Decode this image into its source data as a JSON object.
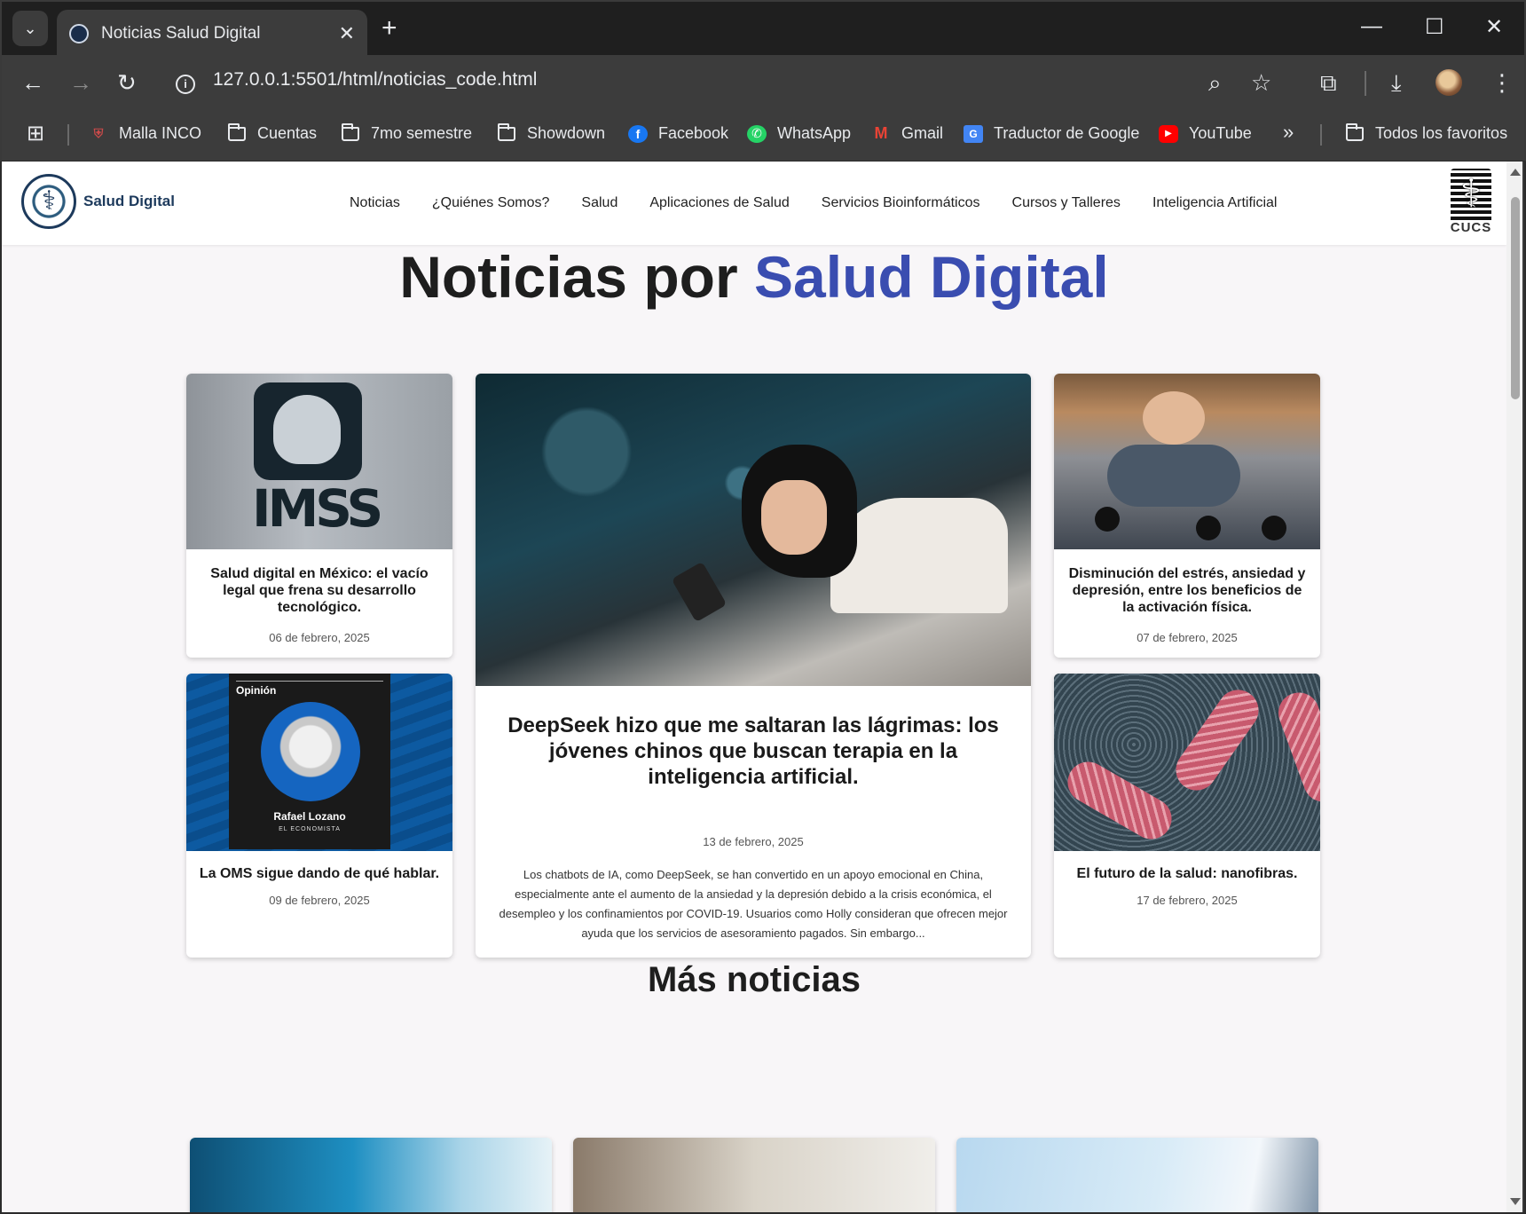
{
  "browser": {
    "tab_title": "Noticias Salud Digital",
    "url": "127.0.0.1:5501/html/noticias_code.html",
    "bookmarks": [
      {
        "label": "Malla INCO",
        "icon": "site-icon"
      },
      {
        "label": "Cuentas",
        "icon": "folder-icon"
      },
      {
        "label": "7mo semestre",
        "icon": "folder-icon"
      },
      {
        "label": "Showdown",
        "icon": "folder-icon"
      },
      {
        "label": "Facebook",
        "icon": "facebook-icon"
      },
      {
        "label": "WhatsApp",
        "icon": "whatsapp-icon"
      },
      {
        "label": "Gmail",
        "icon": "gmail-icon"
      },
      {
        "label": "Traductor de Google",
        "icon": "google-translate-icon"
      },
      {
        "label": "YouTube",
        "icon": "youtube-icon"
      }
    ],
    "all_bookmarks_label": "Todos los favoritos"
  },
  "site": {
    "logo_text": "Salud Digital",
    "nav": [
      "Noticias",
      "¿Quiénes Somos?",
      "Salud",
      "Aplicaciones de Salud",
      "Servicios Bioinformáticos",
      "Cursos y Talleres",
      "Inteligencia Artificial"
    ],
    "cucs_label": "CUCS"
  },
  "hero": {
    "title_main": "Noticias por ",
    "title_accent": "Salud Digital",
    "accent_color": "#3a4db0"
  },
  "news": {
    "card1": {
      "title": "Salud digital en México: el vacío legal que frena su desarrollo tecnológico.",
      "date": "06 de febrero, 2025",
      "image_text": "IMSS"
    },
    "card2": {
      "title": "La OMS sigue dando de qué hablar.",
      "date": "09 de febrero, 2025",
      "image_label": "Opinión",
      "image_name": "Rafael Lozano",
      "image_pub": "EL ECONOMISTA"
    },
    "featured": {
      "title": "DeepSeek hizo que me saltaran las lágrimas: los jóvenes chinos que buscan terapia en la inteligencia artificial.",
      "date": "13 de febrero, 2025",
      "description": "Los chatbots de IA, como DeepSeek, se han convertido en un apoyo emocional en China, especialmente ante el aumento de la ansiedad y la depresión debido a la crisis económica, el desempleo y los confinamientos por COVID-19. Usuarios como Holly consideran que ofrecen mejor ayuda que los servicios de asesoramiento pagados. Sin embargo..."
    },
    "card3": {
      "title": "Disminución del estrés, ansiedad y depresión, entre los beneficios de la activación física.",
      "date": "07 de febrero, 2025"
    },
    "card4": {
      "title": "El futuro de la salud: nanofibras.",
      "date": "17 de febrero, 2025"
    }
  },
  "more_news": {
    "title": "Más noticias"
  }
}
